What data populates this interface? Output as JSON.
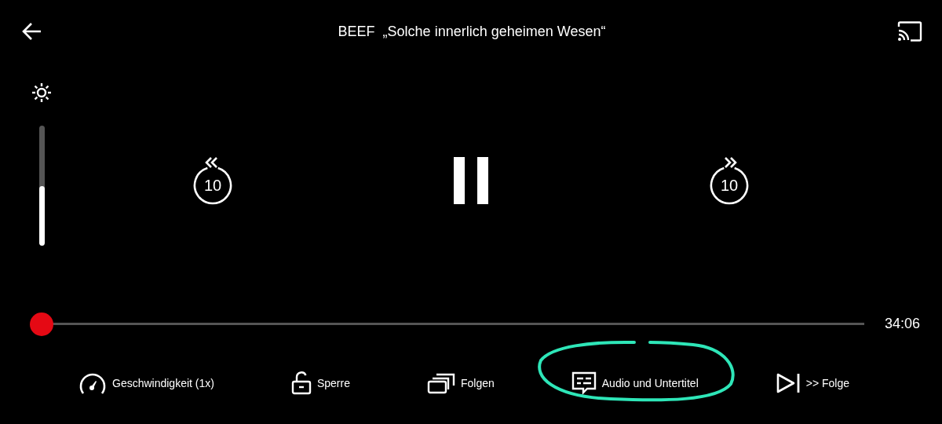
{
  "header": {
    "show": "BEEF",
    "episode": "„Solche innerlich geheimen Wesen“"
  },
  "brightness": {
    "level": 0.5
  },
  "playback": {
    "playing": true,
    "skip_back": "10",
    "skip_forward": "10"
  },
  "progress": {
    "level": 0,
    "remaining": "34:06"
  },
  "controls": [
    {
      "kind": "speed",
      "label": "Geschwindigkeit (1x)",
      "highlighted": false
    },
    {
      "kind": "lock",
      "label": "Sperre",
      "highlighted": false
    },
    {
      "kind": "episodes",
      "label": "Folgen",
      "highlighted": false
    },
    {
      "kind": "subtitles",
      "label": "Audio und Untertitel",
      "highlighted": true
    },
    {
      "kind": "next",
      "label": ">> Folge",
      "highlighted": false
    }
  ]
}
